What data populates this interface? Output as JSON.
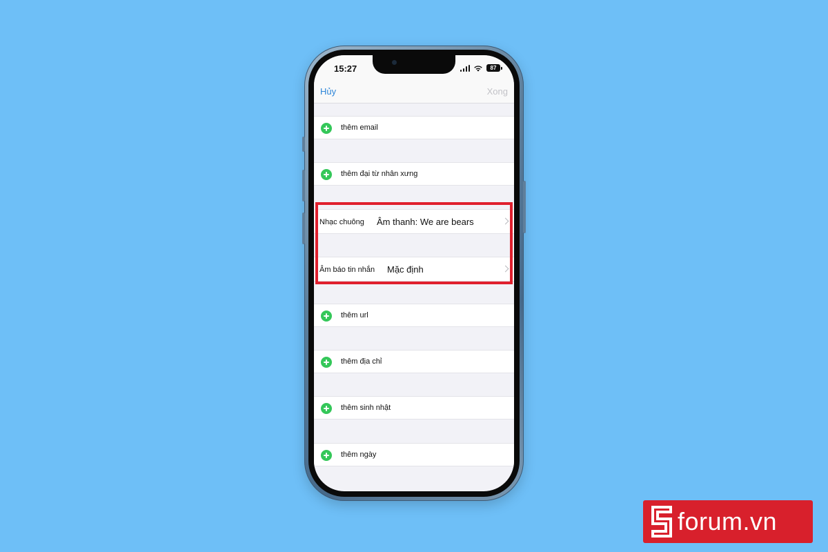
{
  "status_bar": {
    "time": "15:27",
    "battery": "87"
  },
  "nav": {
    "cancel_label": "Hủy",
    "done_label": "Xong"
  },
  "rows": {
    "add_email": "thêm email",
    "add_pronoun": "thêm đại từ nhân xưng",
    "add_url": "thêm url",
    "add_address": "thêm địa chỉ",
    "add_birthday": "thêm sinh nhật",
    "add_date": "thêm ngày"
  },
  "ringtone": {
    "label": "Nhạc chuông",
    "value": "Âm thanh: We are bears"
  },
  "text_tone": {
    "label": "Âm báo tin nhắn",
    "value": "Mặc định"
  },
  "watermark": {
    "brand": "forum.vn"
  },
  "colors": {
    "background": "#6ebff7",
    "accent_link": "#2f86d8",
    "add_green": "#34c759",
    "highlight_red": "#e0202e",
    "brand_red": "#d8202c"
  }
}
